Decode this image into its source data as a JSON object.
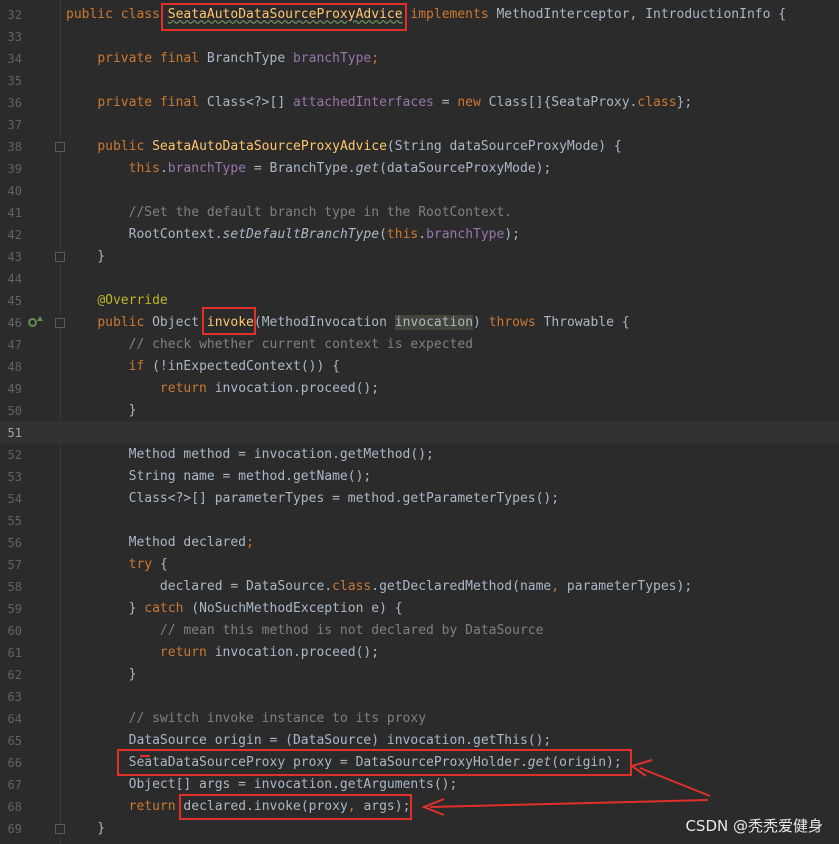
{
  "lines": [
    {
      "n": "32",
      "t": [
        [
          "kw",
          "public class "
        ],
        [
          "fn ul",
          "SeataAutoDataSourceProxyAdvice"
        ],
        [
          "kw",
          " implements "
        ],
        [
          "plain",
          "MethodInterceptor, IntroductionInfo {"
        ]
      ]
    },
    {
      "n": "33",
      "t": []
    },
    {
      "n": "34",
      "t": [
        [
          "plain",
          "    "
        ],
        [
          "kw",
          "private final "
        ],
        [
          "plain",
          "BranchType "
        ],
        [
          "field",
          "branchType"
        ],
        [
          "kw",
          ";"
        ]
      ]
    },
    {
      "n": "35",
      "t": []
    },
    {
      "n": "36",
      "t": [
        [
          "plain",
          "    "
        ],
        [
          "kw",
          "private final "
        ],
        [
          "plain",
          "Class<?>[] "
        ],
        [
          "field",
          "attachedInterfaces"
        ],
        [
          "plain",
          " = "
        ],
        [
          "kw",
          "new "
        ],
        [
          "plain",
          "Class[]{SeataProxy."
        ],
        [
          "kw",
          "class"
        ],
        [
          "plain",
          "};"
        ]
      ]
    },
    {
      "n": "37",
      "t": []
    },
    {
      "n": "38",
      "t": [
        [
          "plain",
          "    "
        ],
        [
          "kw",
          "public "
        ],
        [
          "fn",
          "SeataAutoDataSourceProxyAdvice"
        ],
        [
          "plain",
          "(String dataSourceProxyMode) {"
        ]
      ]
    },
    {
      "n": "39",
      "t": [
        [
          "plain",
          "        "
        ],
        [
          "kw",
          "this"
        ],
        [
          "plain",
          "."
        ],
        [
          "field",
          "branchType"
        ],
        [
          "plain",
          " = BranchType."
        ],
        [
          "plain italic",
          "get"
        ],
        [
          "plain",
          "(dataSourceProxyMode);"
        ]
      ]
    },
    {
      "n": "40",
      "t": []
    },
    {
      "n": "41",
      "t": [
        [
          "plain",
          "        "
        ],
        [
          "cmt",
          "//Set the default branch type in the RootContext."
        ]
      ]
    },
    {
      "n": "42",
      "t": [
        [
          "plain",
          "        RootContext."
        ],
        [
          "plain italic",
          "setDefaultBranchType"
        ],
        [
          "plain",
          "("
        ],
        [
          "kw",
          "this"
        ],
        [
          "plain",
          "."
        ],
        [
          "field",
          "branchType"
        ],
        [
          "plain",
          ");"
        ]
      ]
    },
    {
      "n": "43",
      "t": [
        [
          "plain",
          "    }"
        ]
      ]
    },
    {
      "n": "44",
      "t": []
    },
    {
      "n": "45",
      "t": [
        [
          "plain",
          "    "
        ],
        [
          "ann",
          "@Override"
        ]
      ]
    },
    {
      "n": "46",
      "t": [
        [
          "plain",
          "    "
        ],
        [
          "kw",
          "public "
        ],
        [
          "plain",
          "Object "
        ],
        [
          "fn",
          "invoke"
        ],
        [
          "plain",
          "(MethodInvocation "
        ],
        [
          "plain hl-bg",
          "invocation"
        ],
        [
          "plain",
          ") "
        ],
        [
          "kw",
          "throws "
        ],
        [
          "plain",
          "Throwable {"
        ]
      ]
    },
    {
      "n": "47",
      "t": [
        [
          "plain",
          "        "
        ],
        [
          "cmt",
          "// check whether current context is expected"
        ]
      ]
    },
    {
      "n": "48",
      "t": [
        [
          "plain",
          "        "
        ],
        [
          "kw",
          "if "
        ],
        [
          "plain",
          "(!inExpectedContext()) {"
        ]
      ]
    },
    {
      "n": "49",
      "t": [
        [
          "plain",
          "            "
        ],
        [
          "kw",
          "return "
        ],
        [
          "plain",
          "invocation.proceed();"
        ]
      ]
    },
    {
      "n": "50",
      "t": [
        [
          "plain",
          "        }"
        ]
      ]
    },
    {
      "n": "51",
      "t": []
    },
    {
      "n": "52",
      "t": [
        [
          "plain",
          "        Method method = invocation.getMethod();"
        ]
      ]
    },
    {
      "n": "53",
      "t": [
        [
          "plain",
          "        String name = method.getName();"
        ]
      ]
    },
    {
      "n": "54",
      "t": [
        [
          "plain",
          "        Class<?>[] parameterTypes = method.getParameterTypes();"
        ]
      ]
    },
    {
      "n": "55",
      "t": []
    },
    {
      "n": "56",
      "t": [
        [
          "plain",
          "        Method declared"
        ],
        [
          "kw",
          ";"
        ]
      ]
    },
    {
      "n": "57",
      "t": [
        [
          "plain",
          "        "
        ],
        [
          "kw",
          "try "
        ],
        [
          "plain",
          "{"
        ]
      ]
    },
    {
      "n": "58",
      "t": [
        [
          "plain",
          "            declared = DataSource."
        ],
        [
          "kw",
          "class"
        ],
        [
          "plain",
          ".getDeclaredMethod(name"
        ],
        [
          "kw",
          ", "
        ],
        [
          "plain",
          "parameterTypes);"
        ]
      ]
    },
    {
      "n": "59",
      "t": [
        [
          "plain",
          "        } "
        ],
        [
          "kw",
          "catch "
        ],
        [
          "plain",
          "(NoSuchMethodException e) {"
        ]
      ]
    },
    {
      "n": "60",
      "t": [
        [
          "plain",
          "            "
        ],
        [
          "cmt",
          "// mean this method is not declared by DataSource"
        ]
      ]
    },
    {
      "n": "61",
      "t": [
        [
          "plain",
          "            "
        ],
        [
          "kw",
          "return "
        ],
        [
          "plain",
          "invocation.proceed();"
        ]
      ]
    },
    {
      "n": "62",
      "t": [
        [
          "plain",
          "        }"
        ]
      ]
    },
    {
      "n": "63",
      "t": []
    },
    {
      "n": "64",
      "t": [
        [
          "plain",
          "        "
        ],
        [
          "cmt",
          "// switch invoke instance to its proxy"
        ]
      ]
    },
    {
      "n": "65",
      "t": [
        [
          "plain",
          "        DataSource origin = (DataSource) invocation.getThis();"
        ]
      ]
    },
    {
      "n": "66",
      "t": [
        [
          "plain",
          "        SeataDataSourceProxy proxy = DataSourceProxyHolder."
        ],
        [
          "plain italic",
          "get"
        ],
        [
          "plain",
          "(origin);"
        ]
      ]
    },
    {
      "n": "67",
      "t": [
        [
          "plain",
          "        Object[] args = invocation.getArguments();"
        ]
      ]
    },
    {
      "n": "68",
      "t": [
        [
          "plain",
          "        "
        ],
        [
          "kw",
          "return "
        ],
        [
          "plain",
          "declared.invoke(proxy"
        ],
        [
          "kw",
          ", "
        ],
        [
          "plain",
          "args);"
        ]
      ]
    },
    {
      "n": "69",
      "t": [
        [
          "plain",
          "    }"
        ]
      ]
    }
  ],
  "watermark": "CSDN @秃秃爱健身",
  "colors": {
    "background": "#2b2b2b",
    "annotation_red": "#e0302a"
  }
}
